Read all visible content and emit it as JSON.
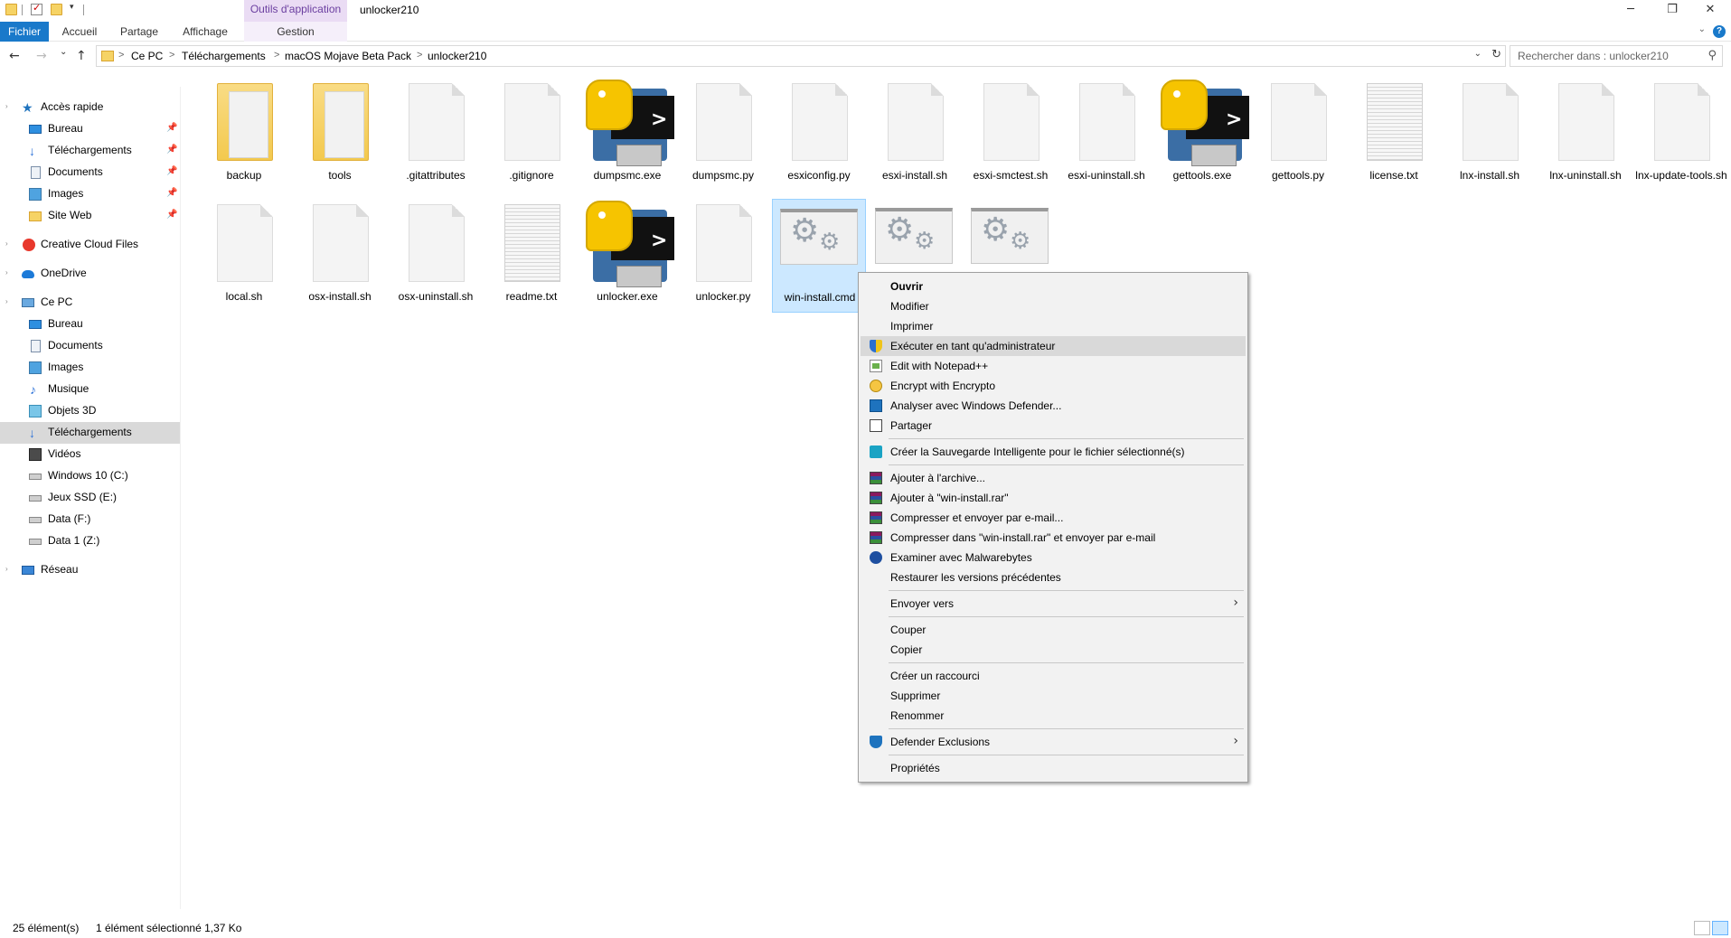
{
  "titlebar": {
    "context_tab": "Outils d'application",
    "window_title": "unlocker210",
    "minimize": "─",
    "restore": "❐",
    "close": "✕"
  },
  "ribbon": {
    "tabs": [
      "Fichier",
      "Accueil",
      "Partage",
      "Affichage",
      "Gestion"
    ],
    "expand": "⌄",
    "help": "?"
  },
  "address": {
    "breadcrumbs": [
      "Ce PC",
      "Téléchargements",
      "macOS Mojave Beta Pack",
      "unlocker210"
    ],
    "separator": ">",
    "nav_back": "←",
    "nav_forward": "→",
    "nav_recent": "⌄",
    "nav_up": "↑",
    "dropdown": "⌄",
    "refresh": "↻",
    "search_placeholder": "Rechercher dans : unlocker210",
    "search_icon": "⚲"
  },
  "sidebar": {
    "items": [
      {
        "label": "Accès rapide",
        "icon": "star-icon"
      },
      {
        "label": "Bureau",
        "icon": "desktop-icon"
      },
      {
        "label": "Téléchargements",
        "icon": "download-icon"
      },
      {
        "label": "Documents",
        "icon": "document-icon"
      },
      {
        "label": "Images",
        "icon": "image-icon"
      },
      {
        "label": "Site Web",
        "icon": "folder-icon"
      },
      {
        "label": "Creative Cloud Files",
        "icon": "creative-cloud-icon"
      },
      {
        "label": "OneDrive",
        "icon": "cloud-icon"
      },
      {
        "label": "Ce PC",
        "icon": "computer-icon"
      },
      {
        "label": "Bureau",
        "icon": "desktop-icon"
      },
      {
        "label": "Documents",
        "icon": "document-icon"
      },
      {
        "label": "Images",
        "icon": "image-icon"
      },
      {
        "label": "Musique",
        "icon": "music-icon"
      },
      {
        "label": "Objets 3D",
        "icon": "cube-icon"
      },
      {
        "label": "Téléchargements",
        "icon": "download-icon"
      },
      {
        "label": "Vidéos",
        "icon": "video-icon"
      },
      {
        "label": "Windows 10 (C:)",
        "icon": "drive-icon"
      },
      {
        "label": "Jeux SSD (E:)",
        "icon": "drive-icon"
      },
      {
        "label": "Data (F:)",
        "icon": "drive-icon"
      },
      {
        "label": "Data 1 (Z:)",
        "icon": "drive-icon"
      },
      {
        "label": "Réseau",
        "icon": "network-icon"
      }
    ],
    "pin": "📌",
    "expander": "›"
  },
  "files": [
    {
      "name": "backup",
      "kind": "folder"
    },
    {
      "name": "tools",
      "kind": "folder"
    },
    {
      "name": ".gitattributes",
      "kind": "doc"
    },
    {
      "name": ".gitignore",
      "kind": "doc"
    },
    {
      "name": "dumpsmc.exe",
      "kind": "exe"
    },
    {
      "name": "dumpsmc.py",
      "kind": "doc"
    },
    {
      "name": "esxiconfig.py",
      "kind": "doc"
    },
    {
      "name": "esxi-install.sh",
      "kind": "doc"
    },
    {
      "name": "esxi-smctest.sh",
      "kind": "doc"
    },
    {
      "name": "esxi-uninstall.sh",
      "kind": "doc"
    },
    {
      "name": "gettools.exe",
      "kind": "exe"
    },
    {
      "name": "gettools.py",
      "kind": "doc"
    },
    {
      "name": "license.txt",
      "kind": "txt"
    },
    {
      "name": "lnx-install.sh",
      "kind": "doc"
    },
    {
      "name": "lnx-uninstall.sh",
      "kind": "doc"
    },
    {
      "name": "lnx-update-tools.sh",
      "kind": "doc"
    },
    {
      "name": "local.sh",
      "kind": "doc"
    },
    {
      "name": "osx-install.sh",
      "kind": "doc"
    },
    {
      "name": "osx-uninstall.sh",
      "kind": "doc"
    },
    {
      "name": "readme.txt",
      "kind": "txt"
    },
    {
      "name": "unlocker.exe",
      "kind": "exe"
    },
    {
      "name": "unlocker.py",
      "kind": "doc"
    },
    {
      "name": "win-install.cmd",
      "kind": "cmd",
      "selected": true
    },
    {
      "name": "",
      "kind": "cmd"
    },
    {
      "name": "",
      "kind": "cmd"
    }
  ],
  "exe_prompt": ">",
  "gear_glyph": "⚙",
  "context_menu": {
    "items": [
      {
        "label": "Ouvrir",
        "bold": true
      },
      {
        "label": "Modifier"
      },
      {
        "label": "Imprimer"
      },
      {
        "label": "Exécuter en tant qu'administrateur",
        "icon": "uac-shield-icon",
        "hover": true
      },
      {
        "label": "Edit with Notepad++",
        "icon": "notepad-plus-plus-icon"
      },
      {
        "label": "Encrypt with Encrypto",
        "icon": "encrypto-lock-icon"
      },
      {
        "label": "Analyser avec Windows Defender...",
        "icon": "windows-defender-icon"
      },
      {
        "label": "Partager",
        "icon": "share-icon"
      },
      {
        "label": "Créer la Sauvegarde Intelligente pour le fichier sélectionné(s)",
        "icon": "smart-backup-icon"
      },
      {
        "label": "Ajouter à l'archive...",
        "icon": "winrar-icon"
      },
      {
        "label": "Ajouter à \"win-install.rar\"",
        "icon": "winrar-icon"
      },
      {
        "label": "Compresser et envoyer par e-mail...",
        "icon": "winrar-icon"
      },
      {
        "label": "Compresser dans \"win-install.rar\" et envoyer par e-mail",
        "icon": "winrar-icon"
      },
      {
        "label": "Examiner avec Malwarebytes",
        "icon": "malwarebytes-icon"
      },
      {
        "label": "Restaurer les versions précédentes"
      },
      {
        "label": "Envoyer vers",
        "submenu": true
      },
      {
        "label": "Couper"
      },
      {
        "label": "Copier"
      },
      {
        "label": "Créer un raccourci"
      },
      {
        "label": "Supprimer"
      },
      {
        "label": "Renommer"
      },
      {
        "label": "Defender Exclusions",
        "icon": "defender-shield-icon",
        "submenu": true
      },
      {
        "label": "Propriétés"
      }
    ],
    "submenu_arrow": "›"
  },
  "status": {
    "count": "25 élément(s)",
    "selection": "1 élément sélectionné  1,37 Ko"
  },
  "colors": {
    "accent": "#1979ca",
    "selection": "#cce8ff",
    "context_tab": "#6b3fa0"
  }
}
